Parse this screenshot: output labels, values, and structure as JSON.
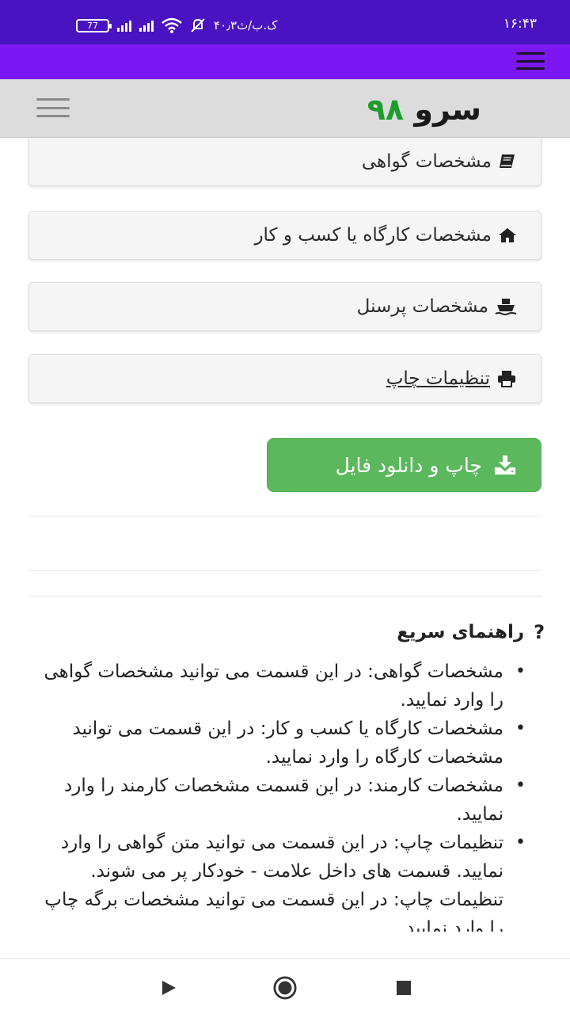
{
  "status_bar": {
    "time": "۱۶:۴۳",
    "battery": "77",
    "carrier_text": "۴۰٫۳ک.ب/ث",
    "icons": [
      "battery-icon",
      "signal-icon",
      "signal-icon",
      "wifi-icon",
      "bell-muted-icon"
    ],
    "color": "#4a13c2"
  },
  "top_bar": {
    "menu_icon": "hamburger-icon",
    "color": "#7a17f2"
  },
  "header": {
    "brand_name": "سرو",
    "brand_number": "۹۸",
    "brand_number_color": "#1d9c2c",
    "menu_icon": "hamburger-icon"
  },
  "panels": [
    {
      "label": "مشخصات گواهی",
      "icon": "book-icon"
    },
    {
      "label": "مشخصات کارگاه یا کسب و کار",
      "icon": "home-icon"
    },
    {
      "label": "مشخصات پرسنل",
      "icon": "ship-icon"
    },
    {
      "label": "تنظیمات چاپ",
      "icon": "printer-icon"
    }
  ],
  "download_button": {
    "label": "چاپ و دانلود فایل",
    "icon": "download-icon",
    "color": "#5cb85c"
  },
  "help": {
    "icon": "question-icon",
    "title": "راهنمای سریع",
    "items": [
      "مشخصات گواهی: در این قسمت می توانید مشخصات گواهی را وارد نمایید.",
      "مشخصات کارگاه یا کسب و کار: در این قسمت می توانید مشخصات کارگاه را وارد نمایید.",
      "مشخصات کارمند: در این قسمت مشخصات کارمند را وارد نمایید.",
      "تنظیمات چاپ: در این قسمت می توانید متن گواهی را وارد نمایید. قسمت های داخل علامت - خودکار پر می شوند.",
      "تنظیمات چاپ: در این قسمت می توانید مشخصات برگه چاپ را وارد نمایید."
    ]
  },
  "nav": {
    "back_icon": "back-triangle-icon",
    "home_icon": "home-circle-icon",
    "recent_icon": "recent-square-icon"
  }
}
